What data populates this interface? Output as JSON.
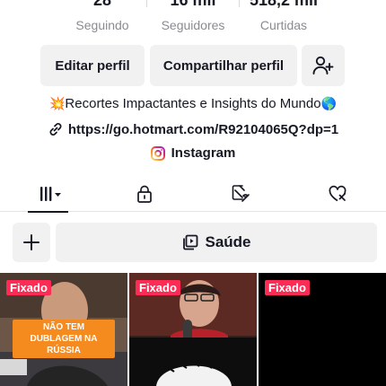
{
  "stats": {
    "following": {
      "value": "28",
      "label": "Seguindo"
    },
    "followers": {
      "value": "16 mil",
      "label": "Seguidores"
    },
    "likes": {
      "value": "518,2 mil",
      "label": "Curtidas"
    }
  },
  "actions": {
    "edit_label": "Editar perfil",
    "share_label": "Compartilhar perfil",
    "add_friend_icon": "add-user-icon"
  },
  "bio": {
    "text": "Recortes Impactantes e Insights do Mundo",
    "leading_emoji": "💥",
    "trailing_emoji": "🌎"
  },
  "link": {
    "icon": "link-icon",
    "url": "https://go.hotmart.com/R92104065Q?dp=1"
  },
  "instagram": {
    "icon": "instagram-icon",
    "label": "Instagram"
  },
  "tabs": [
    {
      "icon": "grid-icon",
      "active": true
    },
    {
      "icon": "lock-icon",
      "active": false
    },
    {
      "icon": "hidden-icon",
      "active": false
    },
    {
      "icon": "liked-icon",
      "active": false
    }
  ],
  "collection": {
    "add_icon": "plus-icon",
    "icon": "playlist-icon",
    "label": "Saúde"
  },
  "videos": [
    {
      "pinned_label": "Fixado",
      "caption": "NÃO TEM DUBLAGEM NA RÚSSIA"
    },
    {
      "pinned_label": "Fixado"
    },
    {
      "pinned_label": "Fixado"
    }
  ],
  "colors": {
    "accent": "#fe2c55",
    "caption_bg": "#f58a1f",
    "button_bg": "#f1f1f2",
    "text": "#161823",
    "muted": "#8a8b91"
  }
}
